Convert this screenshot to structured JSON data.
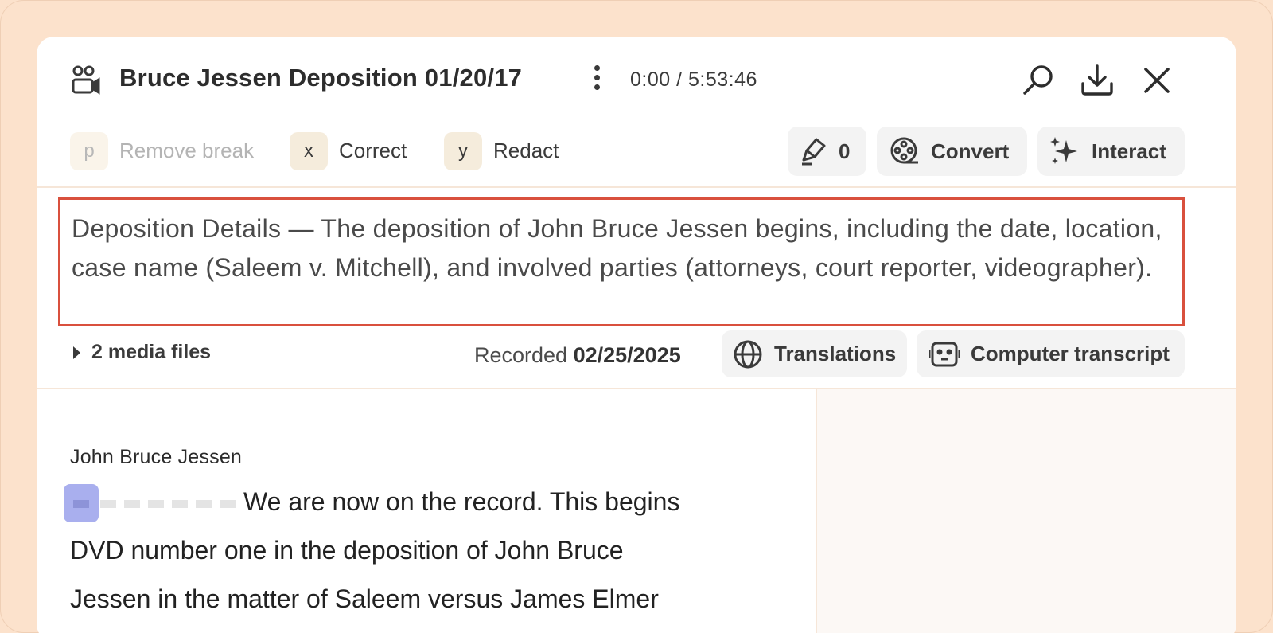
{
  "header": {
    "title": "Bruce Jessen Deposition 01/20/17",
    "time": "0:00 / 5:53:46",
    "icons": [
      "people-video-icon",
      "kebab-menu-icon",
      "search-icon",
      "download-icon",
      "close-icon"
    ]
  },
  "toolbar": {
    "remove_break_key": "p",
    "remove_break_label": "Remove break",
    "correct_key": "x",
    "correct_label": "Correct",
    "redact_key": "y",
    "redact_label": "Redact",
    "highlight_count": "0",
    "convert_label": "Convert",
    "interact_label": "Interact"
  },
  "summary": {
    "text": "Deposition Details — The deposition of John Bruce Jessen begins, including the date, location, case name (Saleem v. Mitchell), and involved parties (attorneys, court reporter, videographer)."
  },
  "meta": {
    "media_files": "2 media files",
    "recorded_label": "Recorded",
    "recorded_date": "02/25/2025",
    "translations_label": "Translations",
    "computer_transcript_label": "Computer transcript"
  },
  "transcript": {
    "speaker": "John Bruce Jessen",
    "lines": [
      "We are now on the record. This begins",
      "DVD number one in the deposition of John Bruce",
      "Jessen in the matter of Saleem versus James Elmer"
    ]
  },
  "colors": {
    "background": "#fce2cc",
    "highlight_border": "#d9503d",
    "key_bg": "#f5ecdc",
    "play_marker": "#a9afee"
  }
}
